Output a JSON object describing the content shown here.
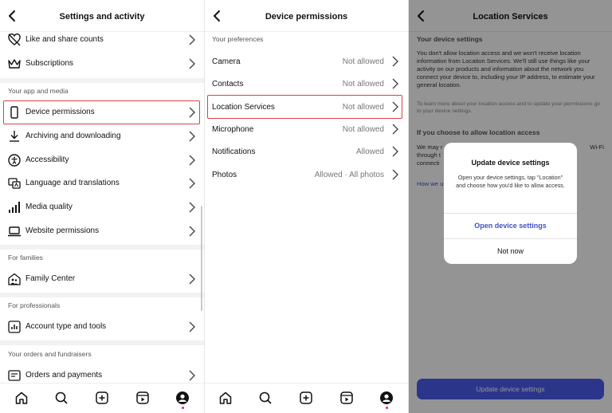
{
  "panel1": {
    "title": "Settings and activity",
    "rows_top": [
      {
        "label": "Like and share counts",
        "icon": "heart-slash-icon"
      },
      {
        "label": "Subscriptions",
        "icon": "crown-icon"
      }
    ],
    "section_app": "Your app and media",
    "rows_app": [
      {
        "label": "Device permissions",
        "icon": "phone-icon"
      },
      {
        "label": "Archiving and downloading",
        "icon": "download-icon"
      },
      {
        "label": "Accessibility",
        "icon": "accessibility-icon"
      },
      {
        "label": "Language and translations",
        "icon": "translate-icon"
      },
      {
        "label": "Media quality",
        "icon": "signal-bars-icon"
      },
      {
        "label": "Website permissions",
        "icon": "laptop-icon"
      }
    ],
    "section_families": "For families",
    "family_row": {
      "label": "Family Center",
      "icon": "family-house-icon"
    },
    "section_professionals": "For professionals",
    "pro_row": {
      "label": "Account type and tools",
      "icon": "chart-icon"
    },
    "section_orders": "Your orders and fundraisers",
    "orders_row": {
      "label": "Orders and payments",
      "icon": "receipt-icon"
    }
  },
  "panel2": {
    "title": "Device permissions",
    "section": "Your preferences",
    "rows": [
      {
        "label": "Camera",
        "value": "Not allowed"
      },
      {
        "label": "Contacts",
        "value": "Not allowed"
      },
      {
        "label": "Location Services",
        "value": "Not allowed"
      },
      {
        "label": "Microphone",
        "value": "Not allowed"
      },
      {
        "label": "Notifications",
        "value": "Allowed"
      },
      {
        "label": "Photos",
        "value": "Allowed · All photos"
      }
    ]
  },
  "panel3": {
    "title": "Location Services",
    "section_device": "Your device settings",
    "body": "You don't allow location access and we won't receive location information from Location Services. We'll still use things like your activity on our products and information about the network you connect your device to, including your IP address, to estimate your general location.",
    "small": "To learn more about your location access and to update your permissions go to your device settings.",
    "section_allow": "If you choose to allow location access",
    "partial_line1": "We may r",
    "partial_line1_right": "Wi-Fi",
    "partial_line2": "through t",
    "partial_line3": "connecti",
    "link_partial": "How we u",
    "button": "Update device settings",
    "dialog": {
      "title": "Update device settings",
      "message": "Open your device settings, tap \"Location\" and choose how you'd like to allow access.",
      "primary": "Open device settings",
      "secondary": "Not now"
    }
  },
  "tabbar_icons": [
    "home-icon",
    "search-icon",
    "create-icon",
    "reels-icon",
    "profile-icon"
  ],
  "colors": {
    "highlight": "#d9414d",
    "link": "#3f51c8",
    "button": "#4a5df0",
    "notification_dot": "#e2245a"
  }
}
